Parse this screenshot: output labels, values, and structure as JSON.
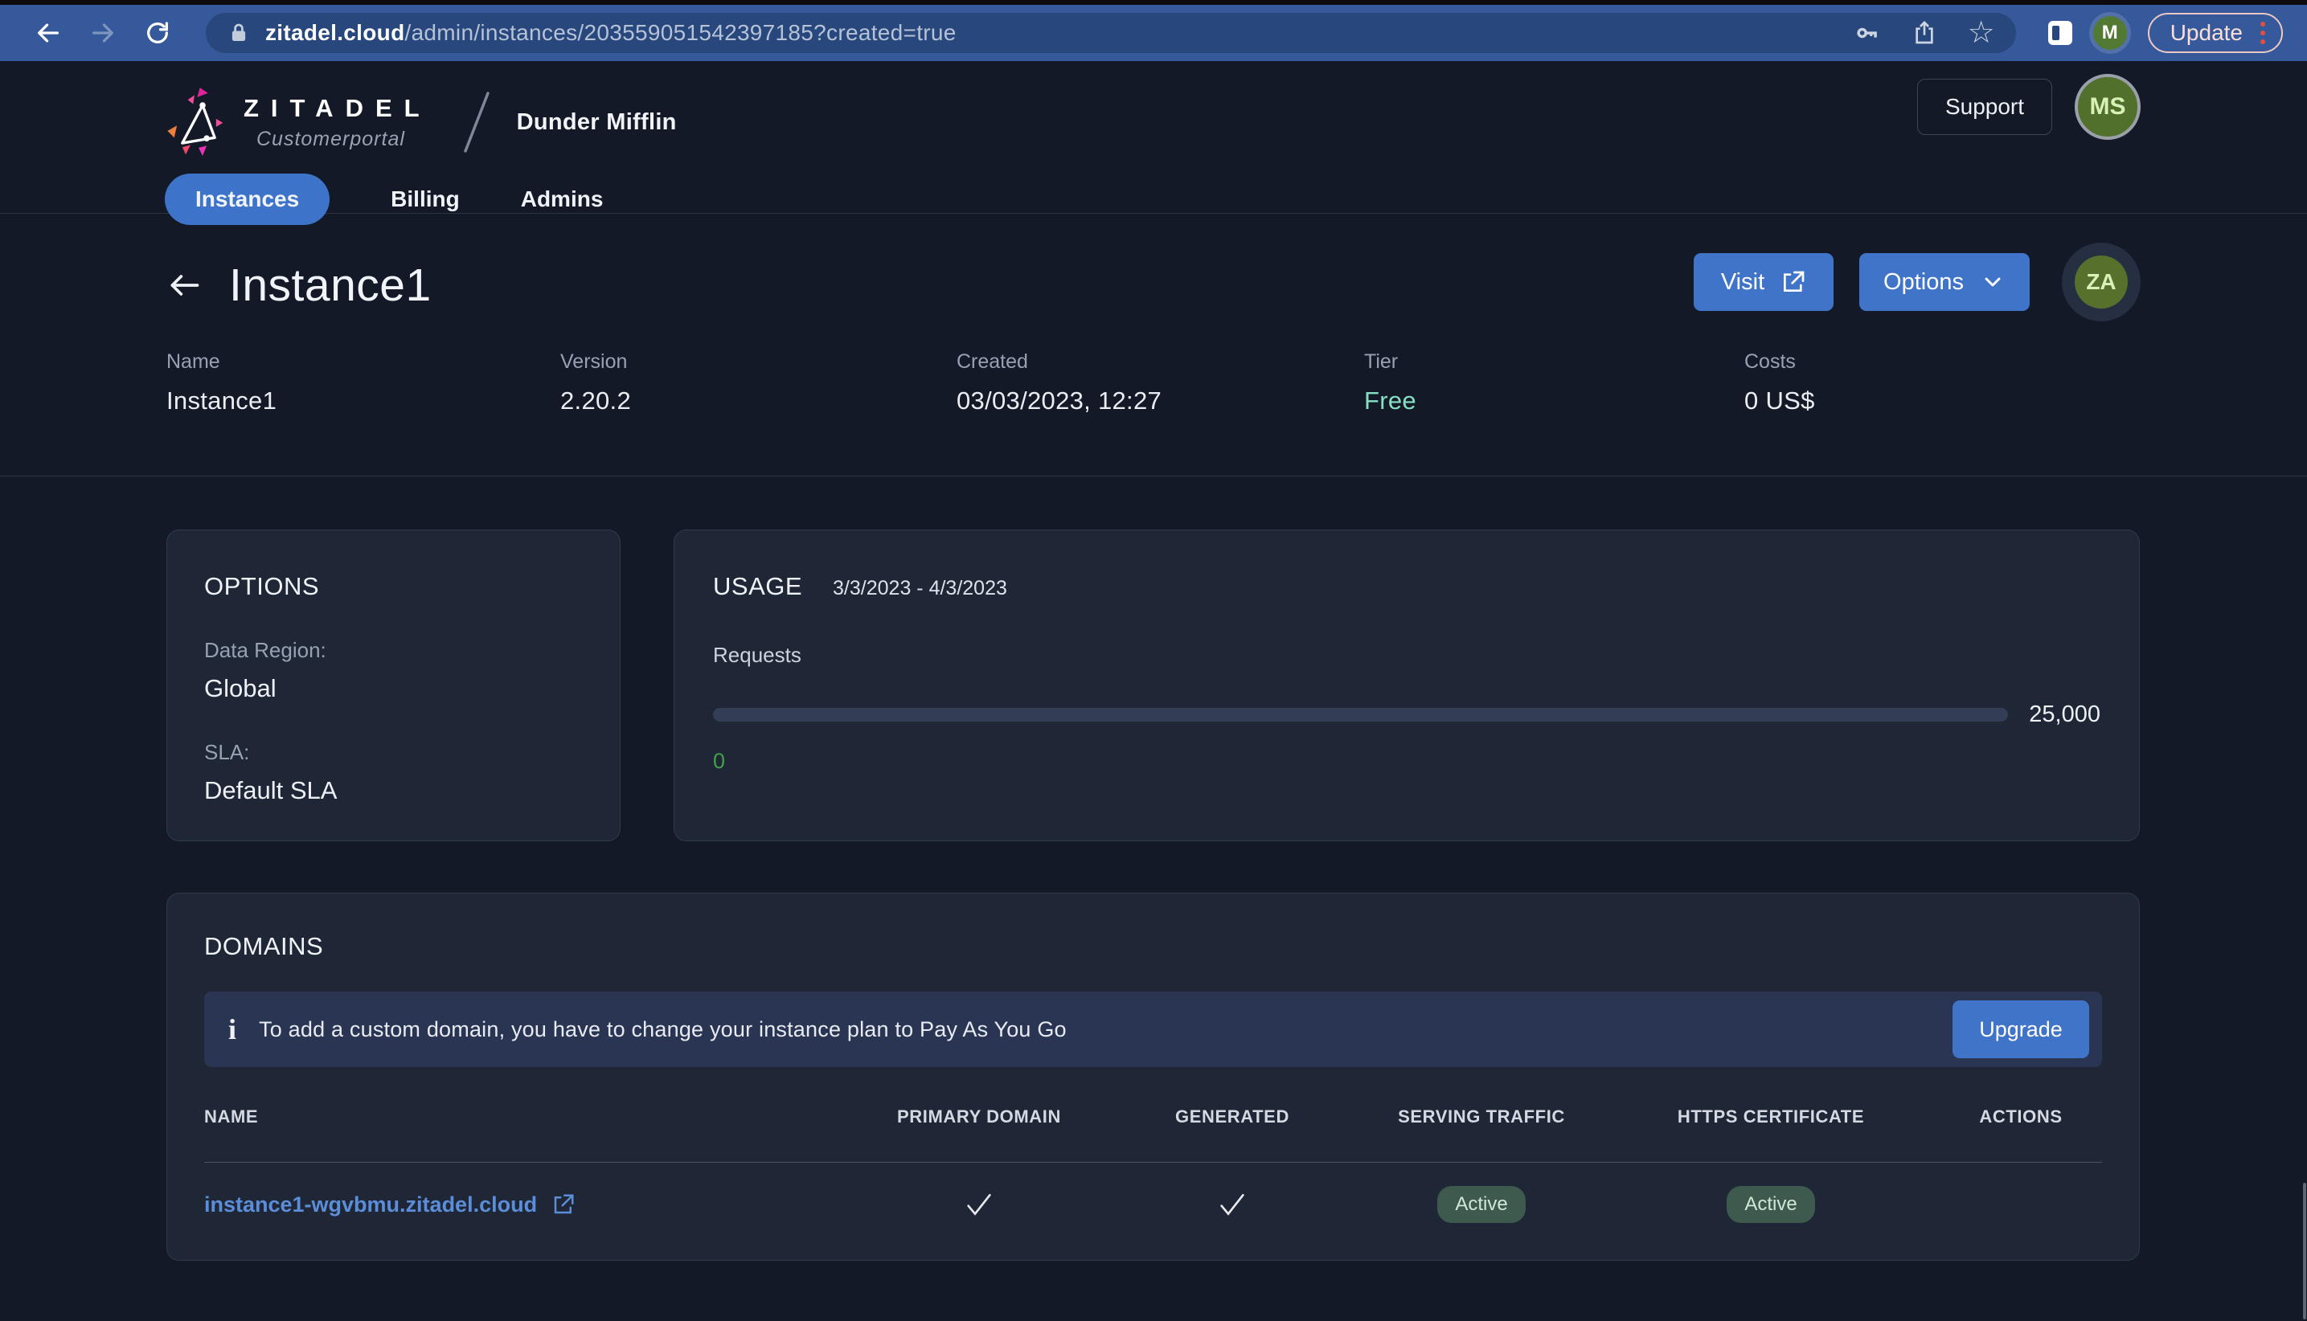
{
  "browser": {
    "url_host": "zitadel.cloud",
    "url_path": "/admin/instances/203559051542397185?created=true",
    "update_label": "Update",
    "profile_initial": "M"
  },
  "header": {
    "logo_title": "ZITADEL",
    "logo_subtitle": "Customerportal",
    "org_name": "Dunder Mifflin",
    "support_label": "Support",
    "avatar_initials": "MS",
    "tabs": [
      {
        "label": "Instances",
        "active": true
      },
      {
        "label": "Billing",
        "active": false
      },
      {
        "label": "Admins",
        "active": false
      }
    ]
  },
  "instance": {
    "title": "Instance1",
    "visit_label": "Visit",
    "options_label": "Options",
    "avatar_initials": "ZA",
    "meta": [
      {
        "label": "Name",
        "value": "Instance1"
      },
      {
        "label": "Version",
        "value": "2.20.2"
      },
      {
        "label": "Created",
        "value": "03/03/2023, 12:27"
      },
      {
        "label": "Tier",
        "value": "Free"
      },
      {
        "label": "Costs",
        "value": "0 US$"
      }
    ]
  },
  "options_card": {
    "title": "OPTIONS",
    "fields": [
      {
        "label": "Data Region:",
        "value": "Global"
      },
      {
        "label": "SLA:",
        "value": "Default SLA"
      }
    ]
  },
  "usage_card": {
    "title": "USAGE",
    "period": "3/3/2023 - 4/3/2023",
    "metric_label": "Requests",
    "limit": "25,000",
    "current": "0",
    "progress_percent": 0
  },
  "domains_card": {
    "title": "DOMAINS",
    "banner_text": "To add a custom domain, you have to change your instance plan to Pay As You Go",
    "upgrade_label": "Upgrade",
    "table": {
      "headers": [
        "NAME",
        "PRIMARY DOMAIN",
        "GENERATED",
        "SERVING TRAFFIC",
        "HTTPS CERTIFICATE",
        "ACTIONS"
      ],
      "rows": [
        {
          "name": "instance1-wgvbmu.zitadel.cloud",
          "primary_domain": true,
          "generated": true,
          "serving_traffic": "Active",
          "https_certificate": "Active"
        }
      ]
    }
  },
  "colors": {
    "accent_blue": "#4074c8",
    "tab_blue": "#3d74c9",
    "tier_mint": "#85e0c3",
    "usage_green": "#41a049",
    "link_blue": "#5b8dd9",
    "badge_green_bg": "#3e5a4e",
    "badge_green_text": "#cfe9d6",
    "toolbar_blue": "#36599b",
    "card_bg": "#1f2736",
    "page_bg": "#131927"
  }
}
